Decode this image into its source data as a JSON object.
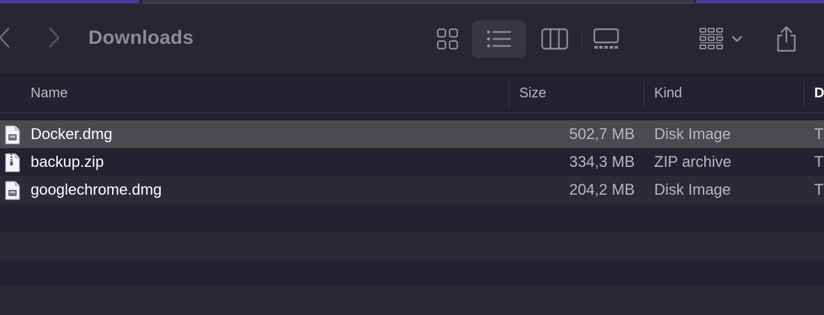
{
  "window": {
    "title": "Downloads"
  },
  "toolbar": {
    "back_icon": "chevron-left-icon",
    "forward_icon": "chevron-right-icon",
    "view_modes": [
      "icon-view",
      "list-view",
      "column-view",
      "gallery-view"
    ],
    "active_view": "list-view",
    "group_icon": "group-by-icon",
    "share_icon": "share-icon"
  },
  "columns": {
    "name": "Name",
    "size": "Size",
    "kind": "Kind",
    "date": "D"
  },
  "files": [
    {
      "name": "Docker.dmg",
      "size": "502,7 MB",
      "kind": "Disk Image",
      "date": "T",
      "icon": "disk-image-icon",
      "selected": true
    },
    {
      "name": "backup.zip",
      "size": "334,3 MB",
      "kind": "ZIP archive",
      "date": "T",
      "icon": "zip-archive-icon",
      "selected": false
    },
    {
      "name": "googlechrome.dmg",
      "size": "204,2 MB",
      "kind": "Disk Image",
      "date": "T",
      "icon": "disk-image-icon",
      "selected": false
    }
  ],
  "colors": {
    "background": "#262130",
    "toolbar": "#2a2532",
    "selection": "#4b4a4f",
    "alt_row": "#2d2937"
  }
}
